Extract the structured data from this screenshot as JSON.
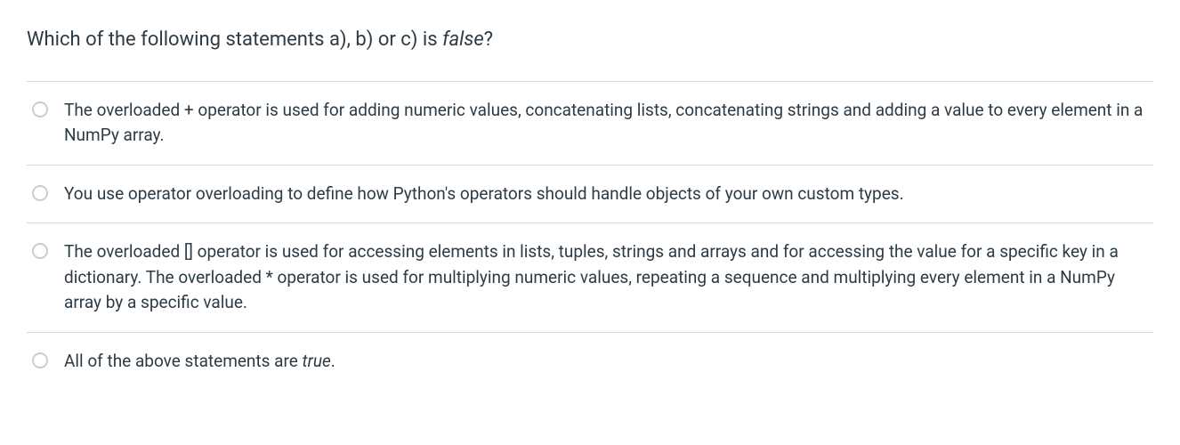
{
  "question": {
    "prefix": "Which of the following statements a), b) or c) is ",
    "emphasized": "false",
    "suffix": "?"
  },
  "options": [
    {
      "text": "The overloaded + operator is used for adding numeric values, concatenating lists, concatenating strings and adding a value to every element in a NumPy array.",
      "has_italic": false
    },
    {
      "text": "You use operator overloading to define how Python's operators should handle objects of your own custom types.",
      "has_italic": false
    },
    {
      "text": "The overloaded [] operator is used for accessing elements in lists, tuples, strings and arrays and for accessing the value for a specific key in a dictionary. The overloaded * operator is used for multiplying numeric values, repeating a sequence and multiplying every element in a NumPy array by a specific value.",
      "has_italic": false
    },
    {
      "text_prefix": "All of the above statements are ",
      "text_italic": "true",
      "text_suffix": ".",
      "has_italic": true
    }
  ]
}
